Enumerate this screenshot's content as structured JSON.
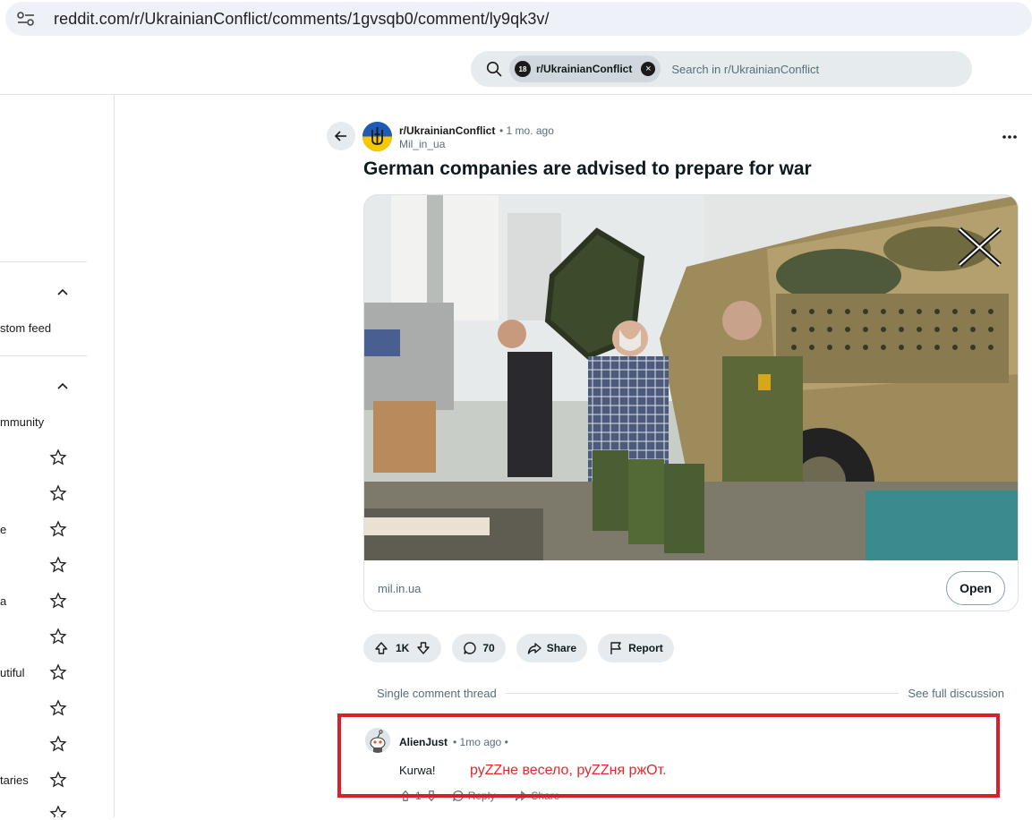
{
  "browser": {
    "url_host": "reddit.com",
    "url_path": "/r/UkrainianConflict/comments/1gvsqb0/comment/ly9qk3v/"
  },
  "header": {
    "chip_avatar": "18",
    "chip_label": "r/UkrainianConflict",
    "search_placeholder": "Search in r/UkrainianConflict"
  },
  "sidebar": {
    "texts": [
      "stom feed",
      "mmunity",
      "e",
      "a",
      "utiful",
      "taries"
    ]
  },
  "post": {
    "subreddit": "r/UkrainianConflict",
    "time": "• 1 mo. ago",
    "author": "Mil_in_ua",
    "title": "German companies are advised to prepare for war",
    "link_domain": "mil.in.ua",
    "open_label": "Open",
    "votes": "1K",
    "comments": "70",
    "share_label": "Share",
    "report_label": "Report"
  },
  "thread": {
    "single_label": "Single comment thread",
    "full_label": "See full discussion"
  },
  "comment": {
    "user": "AlienJust",
    "time": "• 1mo ago •",
    "body": "Kurwa!",
    "votes": "1",
    "reply_label": "Reply",
    "share_label": "Share"
  },
  "annotation": {
    "text": "руZZне весело, руZZня ржОт.",
    "color": "#d9202a"
  },
  "colors": {
    "accent_bg": "#e5ebee",
    "muted_text": "#576f76"
  }
}
